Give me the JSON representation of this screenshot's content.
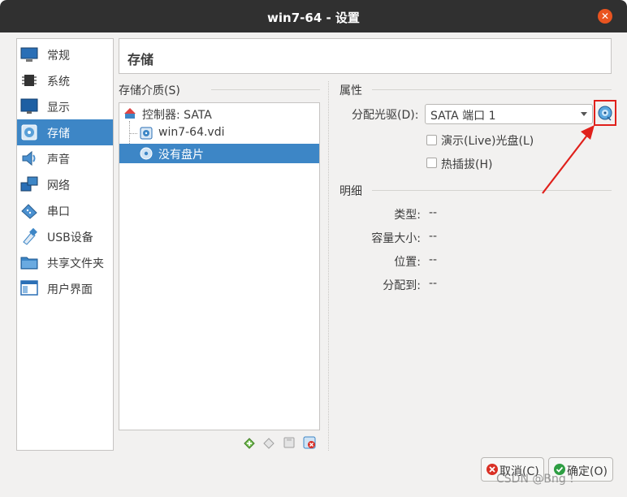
{
  "window": {
    "title": "win7-64 - 设置",
    "close_icon": "close-icon"
  },
  "nav": {
    "items": [
      {
        "label": "常规",
        "icon": "general-icon"
      },
      {
        "label": "系统",
        "icon": "system-chip-icon"
      },
      {
        "label": "显示",
        "icon": "display-monitor-icon"
      },
      {
        "label": "存储",
        "icon": "storage-disk-icon",
        "selected": true
      },
      {
        "label": "声音",
        "icon": "speaker-icon"
      },
      {
        "label": "网络",
        "icon": "network-icon"
      },
      {
        "label": "串口",
        "icon": "serial-port-icon"
      },
      {
        "label": "USB设备",
        "icon": "usb-icon"
      },
      {
        "label": "共享文件夹",
        "icon": "shared-folder-icon"
      },
      {
        "label": "用户界面",
        "icon": "user-interface-icon"
      }
    ]
  },
  "page": {
    "title": "存储"
  },
  "storage_media": {
    "label": "存储介质(S)",
    "tree": [
      {
        "text": "控制器: SATA",
        "icon": "controller-icon"
      },
      {
        "text": "win7-64.vdi",
        "icon": "hard-disk-icon"
      },
      {
        "text": "没有盘片",
        "icon": "optical-disc-icon",
        "selected": true
      }
    ],
    "toolbar_icons": [
      "add-attachment-icon",
      "remove-attachment-icon",
      "add-controller-icon",
      "remove-controller-icon"
    ]
  },
  "attributes": {
    "label": "属性",
    "drive_label": "分配光驱(D):",
    "drive_value": "SATA 端口 1",
    "choose_disc_icon": "choose-disc-icon",
    "live_cd_label": "演示(Live)光盘(L)",
    "live_cd_checked": false,
    "hotplug_label": "热插拔(H)",
    "hotplug_checked": false
  },
  "details": {
    "label": "明细",
    "rows": [
      {
        "key": "类型:",
        "value": "--"
      },
      {
        "key": "容量大小:",
        "value": "--"
      },
      {
        "key": "位置:",
        "value": "--"
      },
      {
        "key": "分配到:",
        "value": "--"
      }
    ]
  },
  "buttons": {
    "cancel": {
      "label": "取消(C)",
      "icon": "cancel-icon"
    },
    "ok": {
      "label": "确定(O)",
      "icon": "ok-check-icon"
    }
  },
  "watermark": "CSDN @Bng !",
  "colors": {
    "selection": "#3d86c6",
    "highlight_red": "#e0201b",
    "titlebar": "#303030",
    "close": "#e95420"
  }
}
